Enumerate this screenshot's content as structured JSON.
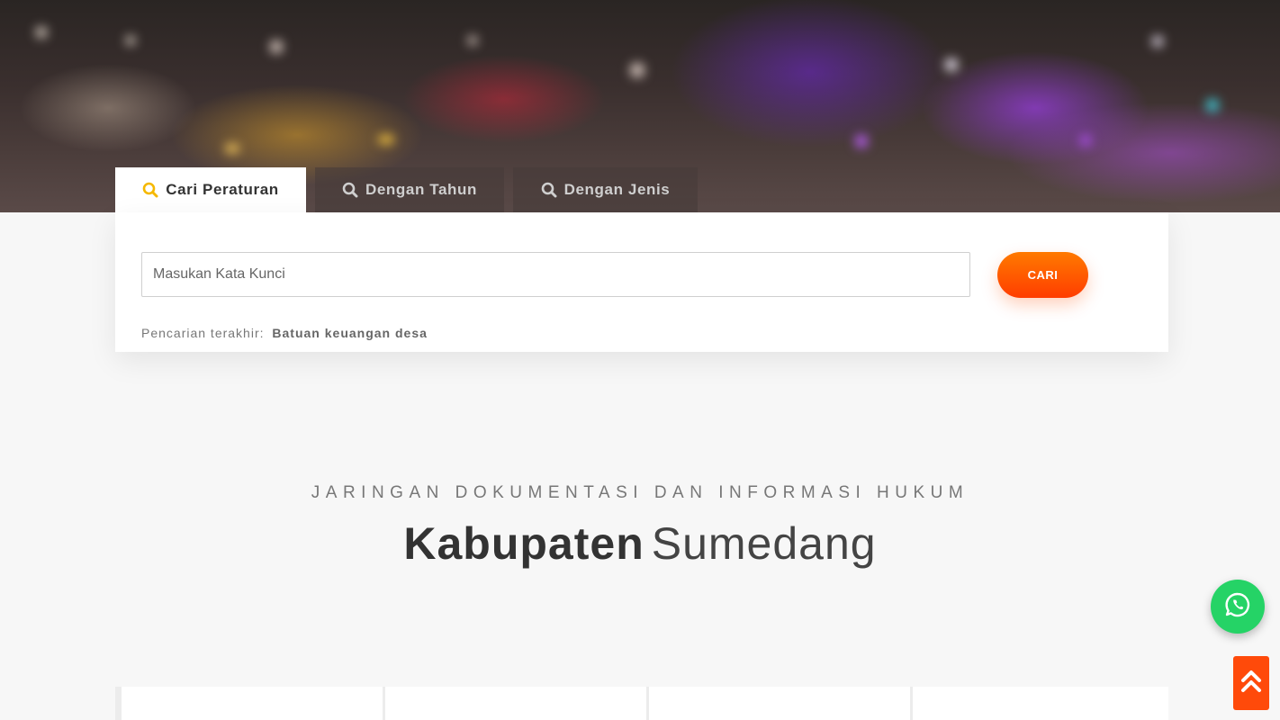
{
  "tabs": [
    {
      "label": "Cari Peraturan",
      "active": true,
      "icon": "search-icon"
    },
    {
      "label": "Dengan Tahun",
      "active": false,
      "icon": "search-icon"
    },
    {
      "label": "Dengan Jenis",
      "active": false,
      "icon": "search-icon"
    }
  ],
  "search": {
    "placeholder": "Masukan Kata Kunci",
    "value": "",
    "button_label": "CARI",
    "recent_label": "Pencarian terakhir:",
    "recent_value": "Batuan keuangan desa"
  },
  "heading": {
    "eyebrow": "JARINGAN DOKUMENTASI DAN INFORMASI HUKUM",
    "title_bold": "Kabupaten",
    "title_light": "Sumedang"
  },
  "floating": {
    "whatsapp_icon": "whatsapp-icon",
    "scroll_top_icon": "double-chevron-up-icon"
  },
  "colors": {
    "accent_orange": "#ff5a00",
    "tab_icon_active": "#f5b800",
    "whatsapp_green": "#25d366"
  }
}
